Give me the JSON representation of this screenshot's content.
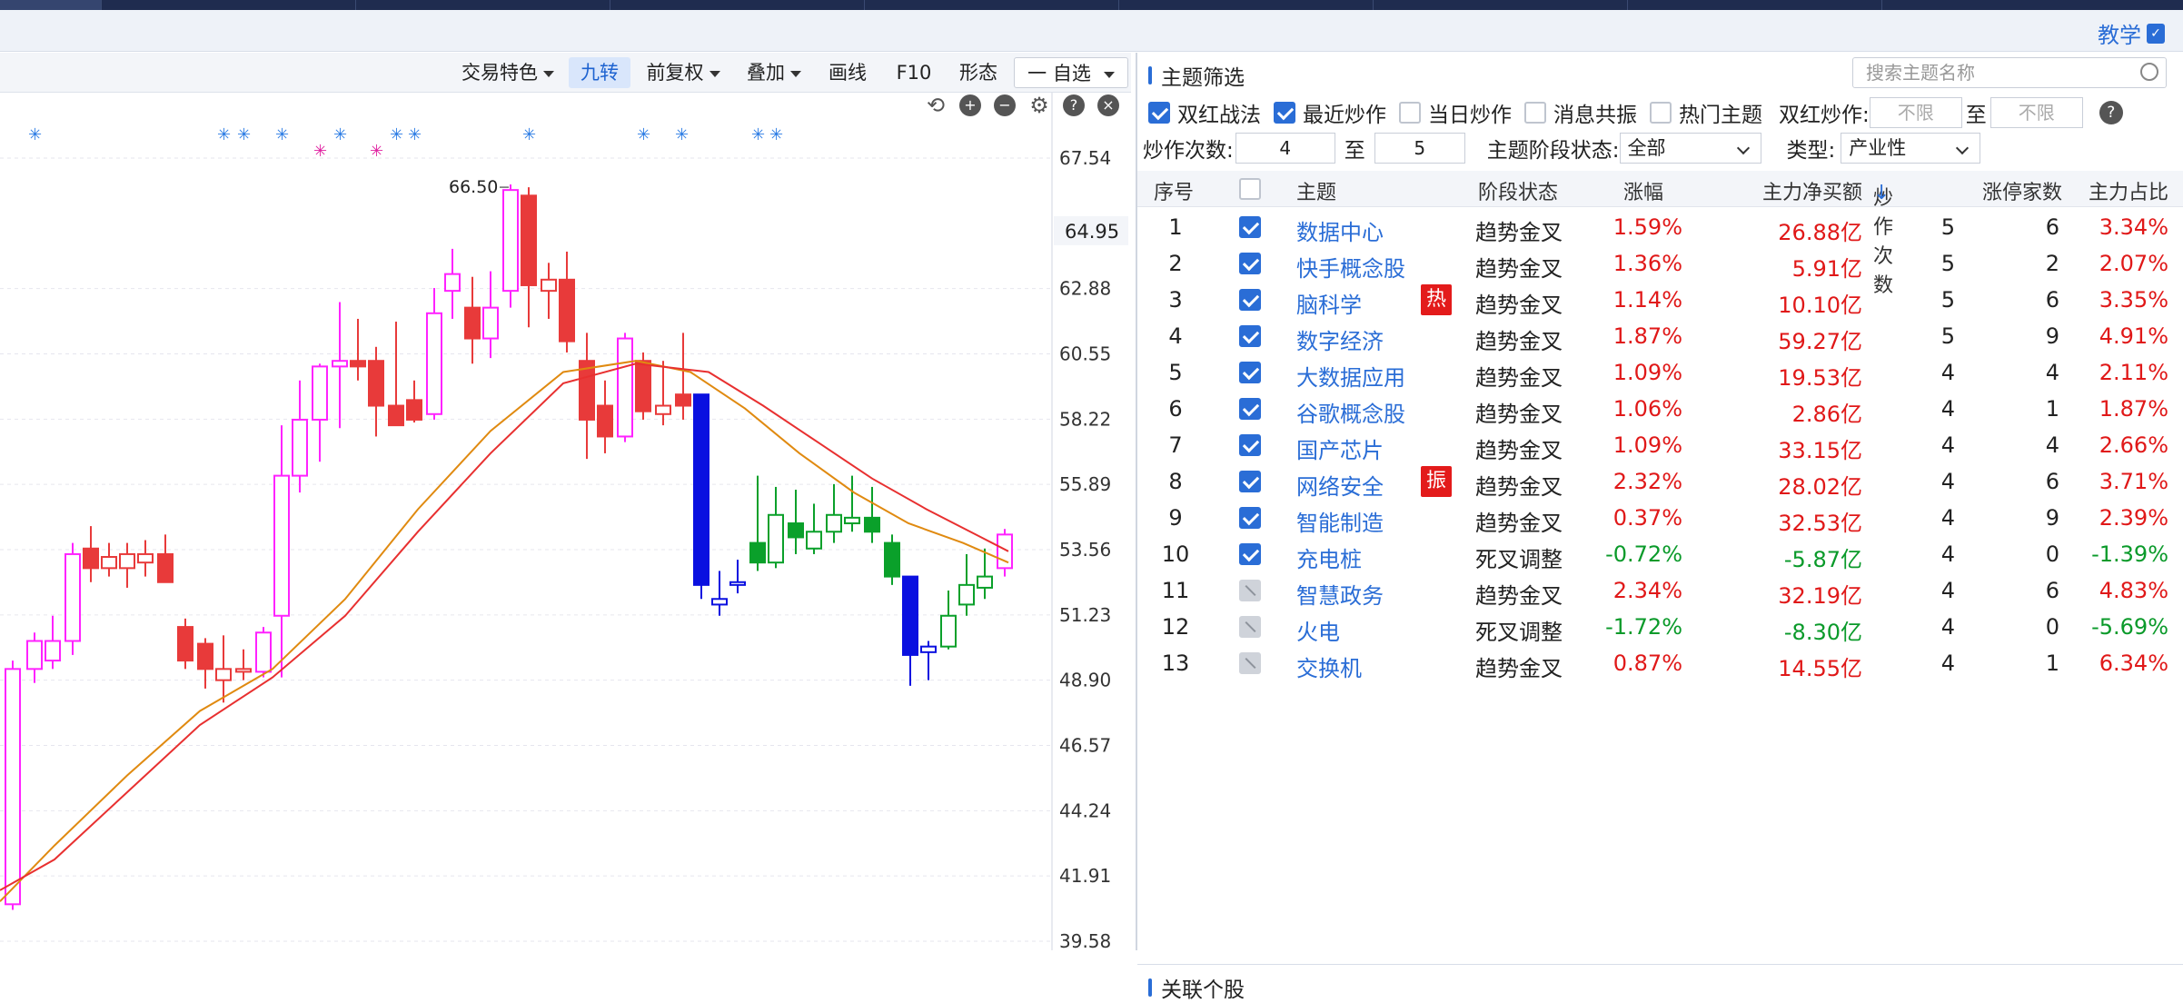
{
  "header": {
    "teach_label": "教学",
    "teach_icon": "book-icon"
  },
  "toolbar": {
    "trade_features": "交易特色",
    "nine_turn": "九转",
    "forward_adjust": "前复权",
    "overlay": "叠加",
    "draw_line": "画线",
    "f10": "F10",
    "pattern": "形态",
    "watchlist": "一 自选"
  },
  "chart": {
    "price_axis": [
      "67.54",
      "62.88",
      "60.55",
      "58.22",
      "55.89",
      "53.56",
      "51.23",
      "48.90",
      "46.57",
      "44.24",
      "41.91",
      "39.58"
    ],
    "current_price": "64.95",
    "high_label": "66.50",
    "colors": {
      "up": "#e83a3a",
      "up_limit": "#ff22ff",
      "down": "#0aa02a",
      "down_big": "#0a10e0",
      "ma_short": "#e08a10",
      "ma_long": "#e83030"
    }
  },
  "panel": {
    "title": "主题筛选",
    "search_placeholder": "搜索主题名称",
    "filters": {
      "double_red": "双红战法",
      "double_red_checked": true,
      "recent": "最近炒作",
      "recent_checked": true,
      "today": "当日炒作",
      "today_checked": false,
      "resonance": "消息共振",
      "resonance_checked": false,
      "hot": "热门主题",
      "hot_checked": false,
      "double_red_hype": "双红炒作:",
      "unlimited": "不限",
      "to": "至"
    },
    "count_label": "炒作次数:",
    "count_from": "4",
    "count_to": "5",
    "stage_label": "主题阶段状态:",
    "stage_value": "全部",
    "type_label": "类型:",
    "type_value": "产业性",
    "columns": [
      "序号",
      "主题",
      "阶段状态",
      "涨幅",
      "主力净买额",
      "炒作次数",
      "涨停家数",
      "主力占比"
    ],
    "sort_arrow": "↓",
    "rows": [
      {
        "idx": "1",
        "checked": true,
        "name": "数据中心",
        "tag": "",
        "stage": "趋势金叉",
        "pct": "1.59%",
        "net": "26.88亿",
        "cnt": "5",
        "zt": "6",
        "ratio": "3.34%",
        "up": true
      },
      {
        "idx": "2",
        "checked": true,
        "name": "快手概念股",
        "tag": "",
        "stage": "趋势金叉",
        "pct": "1.36%",
        "net": "5.91亿",
        "cnt": "5",
        "zt": "2",
        "ratio": "2.07%",
        "up": true
      },
      {
        "idx": "3",
        "checked": true,
        "name": "脑科学",
        "tag": "热",
        "stage": "趋势金叉",
        "pct": "1.14%",
        "net": "10.10亿",
        "cnt": "5",
        "zt": "6",
        "ratio": "3.35%",
        "up": true
      },
      {
        "idx": "4",
        "checked": true,
        "name": "数字经济",
        "tag": "",
        "stage": "趋势金叉",
        "pct": "1.87%",
        "net": "59.27亿",
        "cnt": "5",
        "zt": "9",
        "ratio": "4.91%",
        "up": true
      },
      {
        "idx": "5",
        "checked": true,
        "name": "大数据应用",
        "tag": "",
        "stage": "趋势金叉",
        "pct": "1.09%",
        "net": "19.53亿",
        "cnt": "4",
        "zt": "4",
        "ratio": "2.11%",
        "up": true
      },
      {
        "idx": "6",
        "checked": true,
        "name": "谷歌概念股",
        "tag": "",
        "stage": "趋势金叉",
        "pct": "1.06%",
        "net": "2.86亿",
        "cnt": "4",
        "zt": "1",
        "ratio": "1.87%",
        "up": true
      },
      {
        "idx": "7",
        "checked": true,
        "name": "国产芯片",
        "tag": "",
        "stage": "趋势金叉",
        "pct": "1.09%",
        "net": "33.15亿",
        "cnt": "4",
        "zt": "4",
        "ratio": "2.66%",
        "up": true
      },
      {
        "idx": "8",
        "checked": true,
        "name": "网络安全",
        "tag": "振",
        "stage": "趋势金叉",
        "pct": "2.32%",
        "net": "28.02亿",
        "cnt": "4",
        "zt": "6",
        "ratio": "3.71%",
        "up": true
      },
      {
        "idx": "9",
        "checked": true,
        "name": "智能制造",
        "tag": "",
        "stage": "趋势金叉",
        "pct": "0.37%",
        "net": "32.53亿",
        "cnt": "4",
        "zt": "9",
        "ratio": "2.39%",
        "up": true
      },
      {
        "idx": "10",
        "checked": true,
        "name": "充电桩",
        "tag": "",
        "stage": "死叉调整",
        "pct": "-0.72%",
        "net": "-5.87亿",
        "cnt": "4",
        "zt": "0",
        "ratio": "-1.39%",
        "up": false
      },
      {
        "idx": "11",
        "checked": false,
        "name": "智慧政务",
        "tag": "",
        "stage": "趋势金叉",
        "pct": "2.34%",
        "net": "32.19亿",
        "cnt": "4",
        "zt": "6",
        "ratio": "4.83%",
        "up": true
      },
      {
        "idx": "12",
        "checked": false,
        "name": "火电",
        "tag": "",
        "stage": "死叉调整",
        "pct": "-1.72%",
        "net": "-8.30亿",
        "cnt": "4",
        "zt": "0",
        "ratio": "-5.69%",
        "up": false
      },
      {
        "idx": "13",
        "checked": false,
        "name": "交换机",
        "tag": "",
        "stage": "趋势金叉",
        "pct": "0.87%",
        "net": "14.55亿",
        "cnt": "4",
        "zt": "1",
        "ratio": "6.34%",
        "up": true
      }
    ],
    "related_title": "关联个股"
  }
}
